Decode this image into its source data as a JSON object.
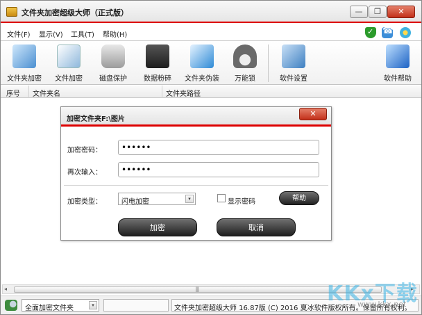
{
  "window": {
    "title": "文件夹加密超级大师（正式版）",
    "min_glyph": "—",
    "max_glyph": "❐",
    "close_glyph": "✕"
  },
  "menu": [
    "文件(F)",
    "显示(V)",
    "工具(T)",
    "帮助(H)"
  ],
  "menu_icons": [
    "shield-icon",
    "phone-icon",
    "flower-icon"
  ],
  "toolbar": [
    {
      "label": "文件夹加密",
      "icon": "folder-lock-icon"
    },
    {
      "label": "文件加密",
      "icon": "file-lock-icon"
    },
    {
      "label": "磁盘保护",
      "icon": "disk-icon"
    },
    {
      "label": "数据粉碎",
      "icon": "shredder-icon"
    },
    {
      "label": "文件夹伪装",
      "icon": "folder-disguise-icon"
    },
    {
      "label": "万能锁",
      "icon": "padlock-icon"
    },
    {
      "label": "软件设置",
      "icon": "settings-icon"
    },
    {
      "label": "软件帮助",
      "icon": "help-icon"
    }
  ],
  "list": {
    "columns": [
      "序号",
      "文件夹名",
      "文件夹路径"
    ]
  },
  "scrollbar": {
    "left": "◂",
    "grip": "|||",
    "right": "▸"
  },
  "statusbar": {
    "mode": "全面加密文件夹",
    "info": "文件夹加密超级大师 16.87版 (C) 2016  夏冰软件版权所有。保留所有权利。",
    "arrow": "▾"
  },
  "watermark": {
    "main": "KKx下载",
    "sub": "www.kkx.net"
  },
  "dialog": {
    "title": "加密文件夹F:\\图片",
    "close": "✕",
    "password_label": "加密密码：",
    "password_value": "••••••",
    "repeat_label": "再次输入：",
    "repeat_value": "••••••",
    "type_label": "加密类型：",
    "type_value": "闪电加密",
    "type_arrow": "▾",
    "show_password_label": "显示密码",
    "help": "帮助",
    "ok": "加密",
    "cancel": "取消"
  }
}
